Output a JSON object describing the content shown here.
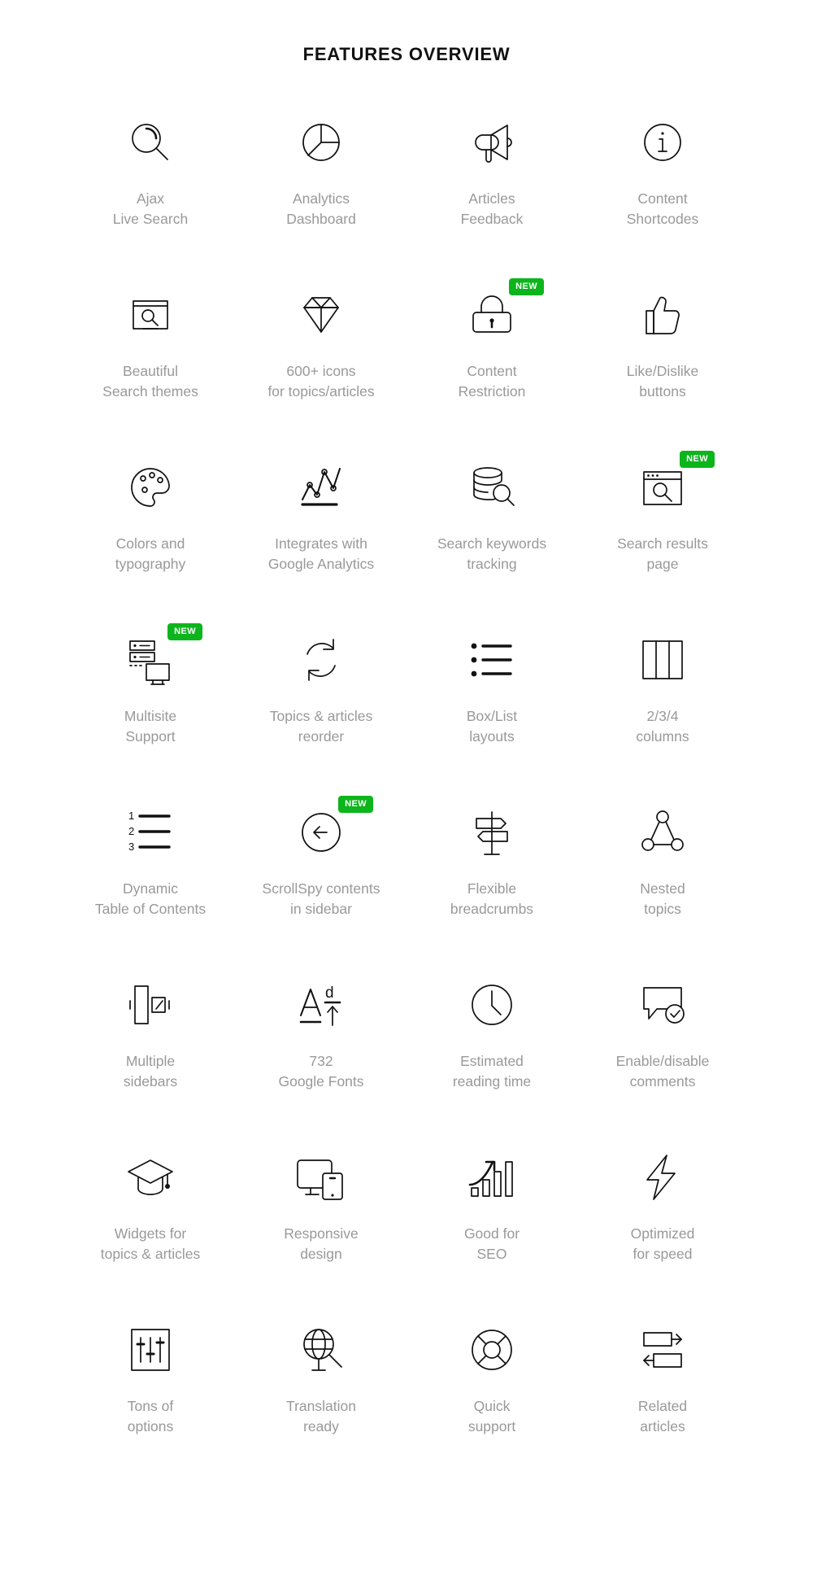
{
  "header": {
    "title": "FEATURES OVERVIEW"
  },
  "theme": {
    "background": "#ffffff",
    "icon_color": "#111111",
    "label_color": "#999999",
    "title_color": "#111111",
    "badge_bg": "#0cb51c",
    "badge_text_color": "#ffffff"
  },
  "badge_label": "NEW",
  "features": [
    {
      "icon": "magnifier-icon",
      "line1": "Ajax",
      "line2": "Live Search",
      "badge": false
    },
    {
      "icon": "pie-chart-icon",
      "line1": "Analytics",
      "line2": "Dashboard",
      "badge": false
    },
    {
      "icon": "megaphone-icon",
      "line1": "Articles",
      "line2": "Feedback",
      "badge": false
    },
    {
      "icon": "info-circle-icon",
      "line1": "Content",
      "line2": "Shortcodes",
      "badge": false
    },
    {
      "icon": "search-box-icon",
      "line1": "Beautiful",
      "line2": "Search themes",
      "badge": false
    },
    {
      "icon": "diamond-icon",
      "line1": "600+ icons",
      "line2": "for topics/articles",
      "badge": false
    },
    {
      "icon": "padlock-icon",
      "line1": "Content",
      "line2": "Restriction",
      "badge": true
    },
    {
      "icon": "thumbs-up-icon",
      "line1": "Like/Dislike",
      "line2": "buttons",
      "badge": false
    },
    {
      "icon": "palette-icon",
      "line1": "Colors and",
      "line2": "typography",
      "badge": false
    },
    {
      "icon": "line-chart-icon",
      "line1": "Integrates with",
      "line2": "Google Analytics",
      "badge": false
    },
    {
      "icon": "database-search-icon",
      "line1": "Search keywords",
      "line2": "tracking",
      "badge": false
    },
    {
      "icon": "browser-search-icon",
      "line1": "Search results",
      "line2": "page",
      "badge": true
    },
    {
      "icon": "server-desktop-icon",
      "line1": "Multisite",
      "line2": "Support",
      "badge": true
    },
    {
      "icon": "refresh-cycle-icon",
      "line1": "Topics & articles",
      "line2": "reorder",
      "badge": false
    },
    {
      "icon": "bullet-list-icon",
      "line1": "Box/List",
      "line2": "layouts",
      "badge": false
    },
    {
      "icon": "columns-icon",
      "line1": "2/3/4",
      "line2": "columns",
      "badge": false
    },
    {
      "icon": "numbered-list-icon",
      "line1": "Dynamic",
      "line2": "Table of Contents",
      "badge": false
    },
    {
      "icon": "arrow-left-circle-icon",
      "line1": "ScrollSpy contents",
      "line2": "in sidebar",
      "badge": true
    },
    {
      "icon": "signpost-icon",
      "line1": "Flexible",
      "line2": "breadcrumbs",
      "badge": false
    },
    {
      "icon": "nested-nodes-icon",
      "line1": "Nested",
      "line2": "topics",
      "badge": false
    },
    {
      "icon": "sidebar-panel-icon",
      "line1": "Multiple",
      "line2": "sidebars",
      "badge": false
    },
    {
      "icon": "font-size-icon",
      "line1": "732",
      "line2": "Google Fonts",
      "badge": false
    },
    {
      "icon": "clock-icon",
      "line1": "Estimated",
      "line2": "reading time",
      "badge": false
    },
    {
      "icon": "comment-check-icon",
      "line1": "Enable/disable",
      "line2": "comments",
      "badge": false
    },
    {
      "icon": "graduation-cap-icon",
      "line1": "Widgets for",
      "line2": "topics & articles",
      "badge": false
    },
    {
      "icon": "responsive-devices-icon",
      "line1": "Responsive",
      "line2": "design",
      "badge": false
    },
    {
      "icon": "growth-chart-icon",
      "line1": "Good for",
      "line2": "SEO",
      "badge": false
    },
    {
      "icon": "lightning-bolt-icon",
      "line1": "Optimized",
      "line2": "for speed",
      "badge": false
    },
    {
      "icon": "sliders-icon",
      "line1": "Tons of",
      "line2": "options",
      "badge": false
    },
    {
      "icon": "globe-stand-icon",
      "line1": "Translation",
      "line2": "ready",
      "badge": false
    },
    {
      "icon": "lifebuoy-icon",
      "line1": "Quick",
      "line2": "support",
      "badge": false
    },
    {
      "icon": "related-share-icon",
      "line1": "Related",
      "line2": "articles",
      "badge": false
    }
  ]
}
